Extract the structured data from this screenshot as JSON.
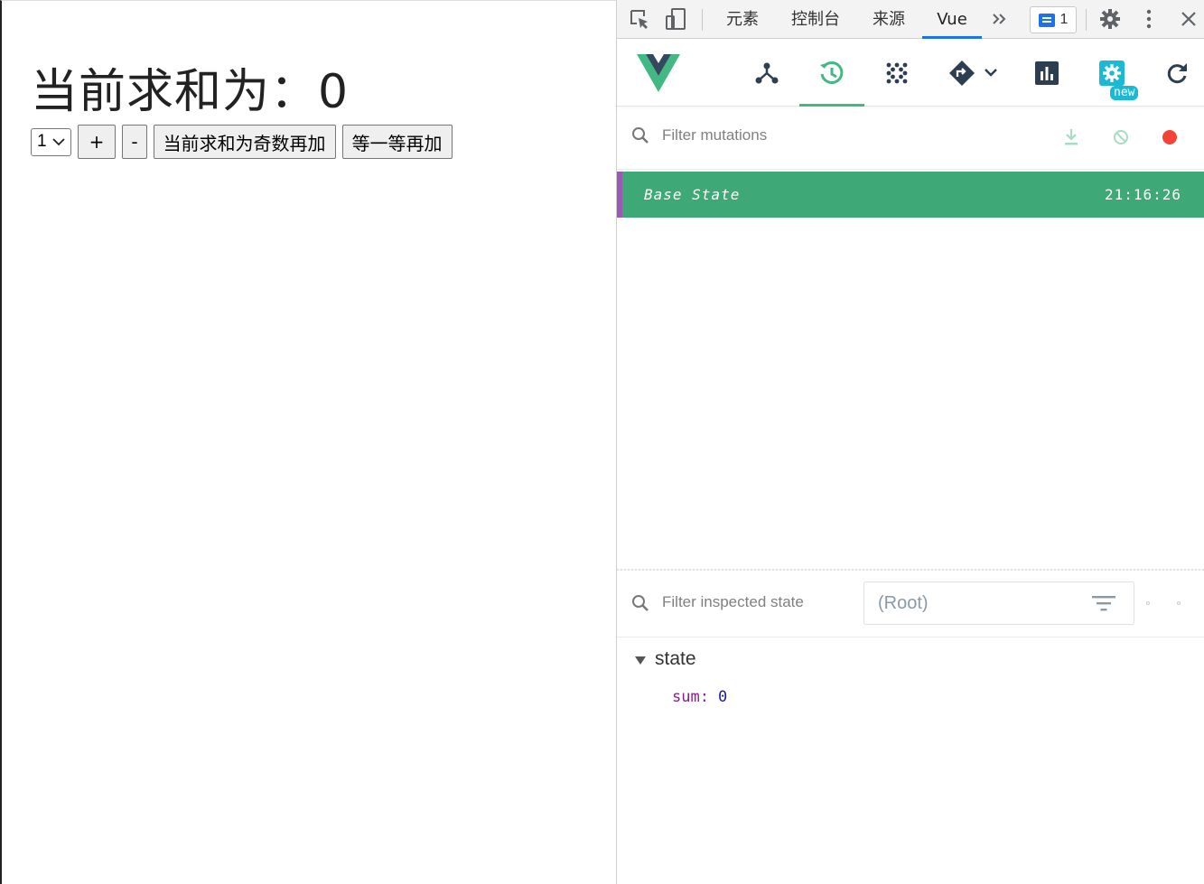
{
  "app": {
    "title": "当前求和为：0",
    "select_value": "1",
    "buttons": {
      "increment": "+",
      "decrement": "-",
      "increment_if_odd": "当前求和为奇数再加",
      "increment_wait": "等一等再加"
    }
  },
  "devtools": {
    "tabs": {
      "elements": "元素",
      "console": "控制台",
      "sources": "来源",
      "vue": "Vue"
    },
    "issues_count": "1",
    "vue_toolbar": {
      "new_tag": "new"
    },
    "mutations": {
      "filter_placeholder": "Filter mutations",
      "base_state_label": "Base State",
      "base_state_time": "21:16:26"
    },
    "inspector": {
      "filter_placeholder": "Filter inspected state",
      "root_select": "(Root)",
      "section": "state",
      "props": [
        {
          "key": "sum:",
          "value": "0"
        }
      ]
    },
    "colors": {
      "vue_green": "#42b883",
      "base_state_bg": "#3ea876",
      "record_red": "#f44336",
      "accent_blue": "#1a73e8",
      "settings_cyan": "#1cb9d5"
    }
  }
}
